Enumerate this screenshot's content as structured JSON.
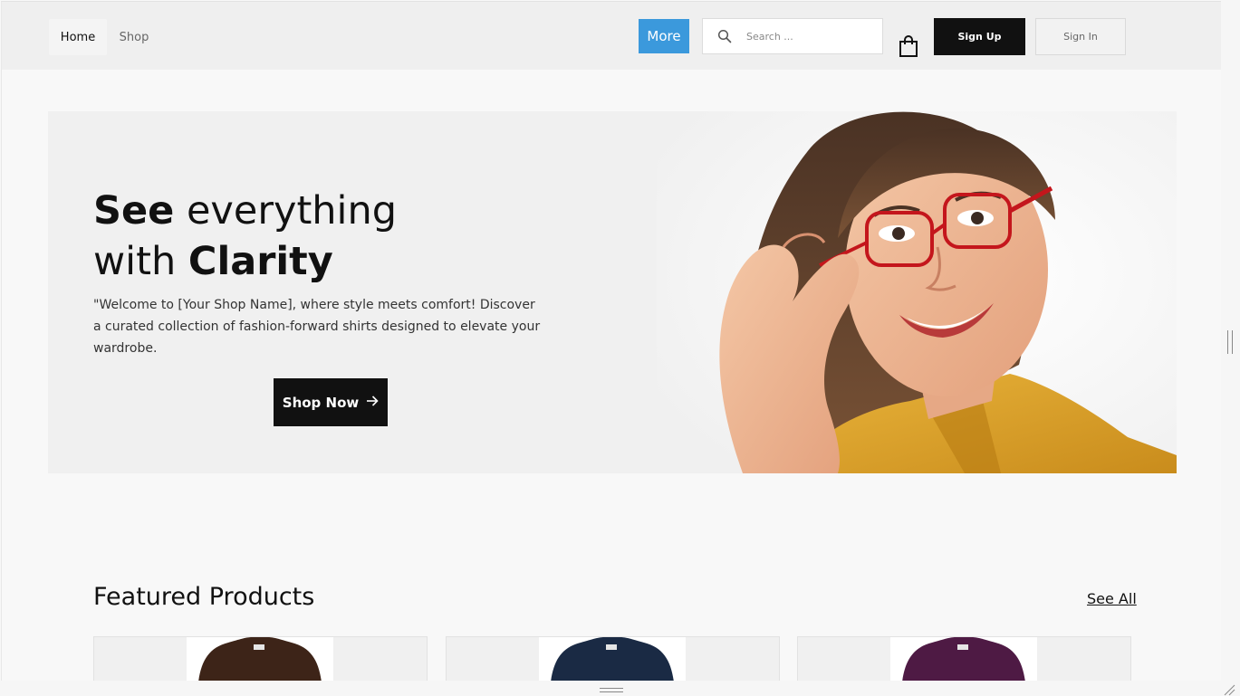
{
  "nav": {
    "home_label": "Home",
    "shop_label": "Shop",
    "more_label": "More"
  },
  "search": {
    "placeholder": "Search ...",
    "value": ""
  },
  "auth": {
    "signup_label": "Sign Up",
    "signin_label": "Sign In"
  },
  "hero": {
    "title_bold_1": "See",
    "title_rest_1": " everything",
    "title_rest_2": "with ",
    "title_bold_2": "Clarity",
    "description": "\"Welcome to [Your Shop Name], where style meets comfort! Discover a curated collection of fashion-forward shirts designed to elevate your wardrobe.",
    "cta_label": "Shop Now"
  },
  "featured": {
    "title": "Featured Products",
    "see_all_label": "See All",
    "products": [
      {
        "shirt_color": "#3d2418"
      },
      {
        "shirt_color": "#1a2a44"
      },
      {
        "shirt_color": "#4e1a44"
      }
    ]
  },
  "colors": {
    "accent": "#3b99dc",
    "dark": "#111111",
    "header_bg": "#efefef",
    "hero_bg": "#f0f0f0"
  },
  "icons": {
    "search": "search-icon",
    "cart": "shopping-bag-icon",
    "arrow": "arrow-right-icon"
  }
}
